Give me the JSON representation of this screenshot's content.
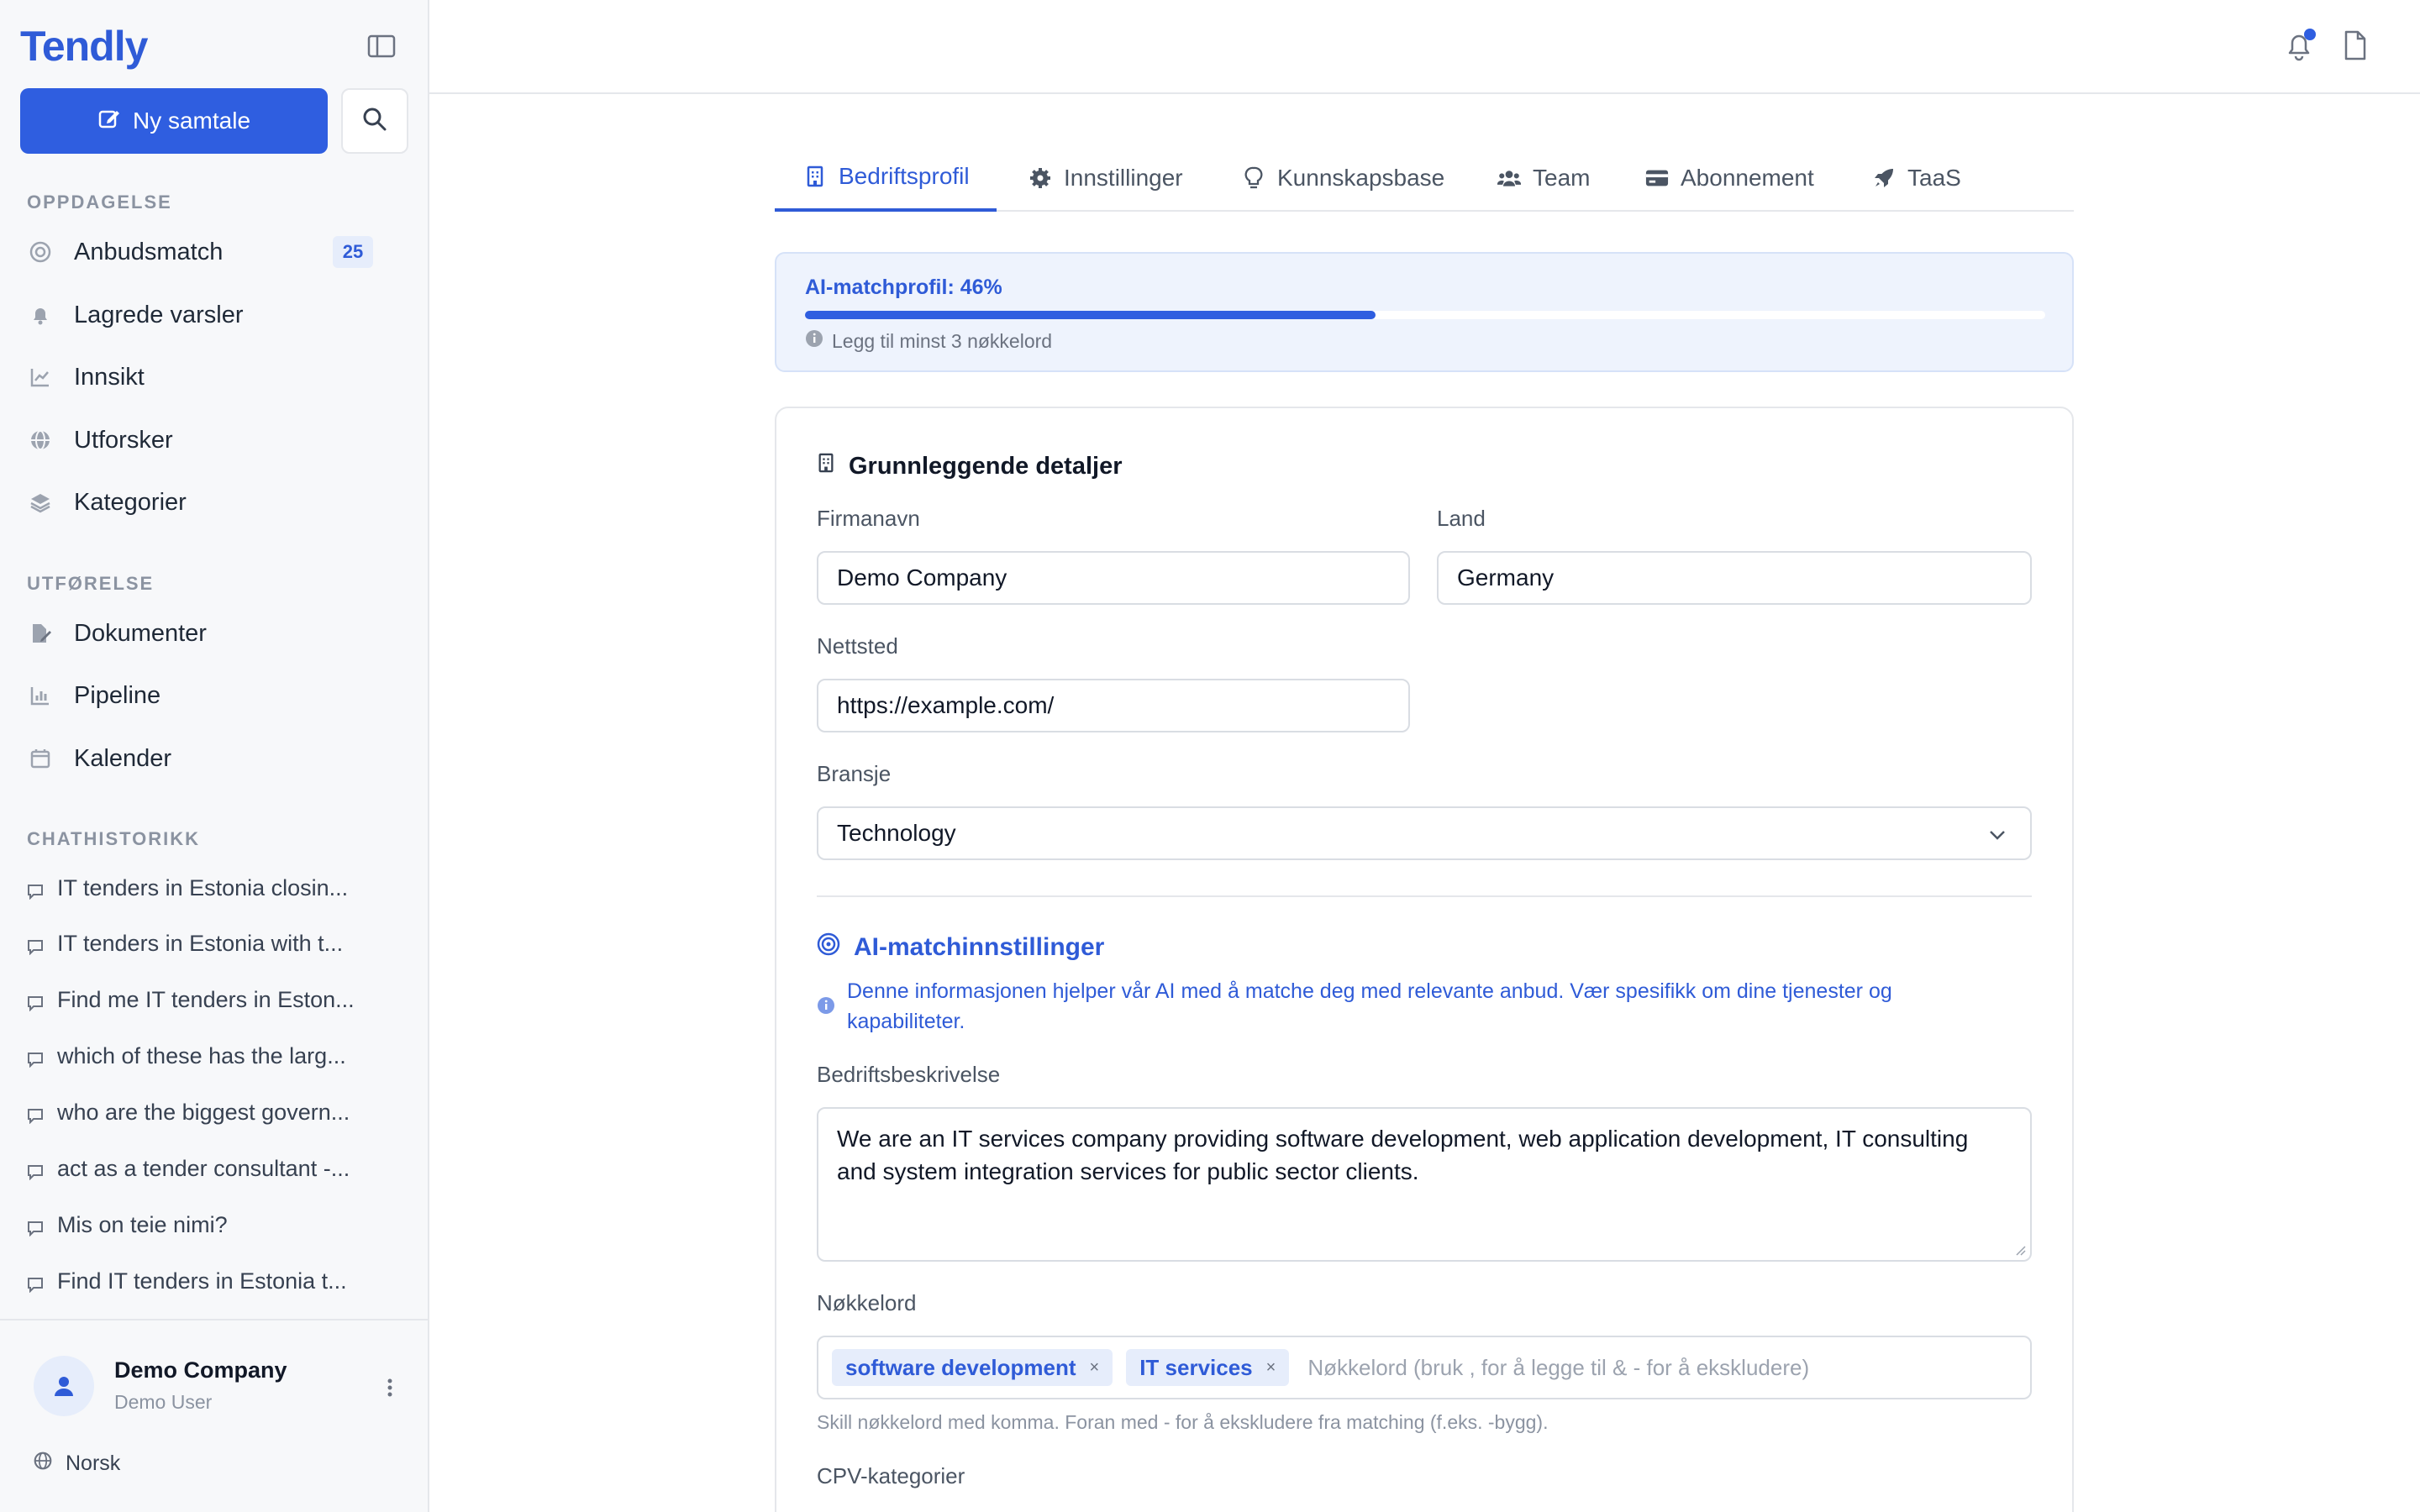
{
  "sidebar": {
    "brand": "Tendly",
    "new_chat_label": "Ny samtale",
    "sections": {
      "discovery": "OPPDAGELSE",
      "execution": "UTFØRELSE",
      "history": "CHATHISTORIKK"
    },
    "discovery_items": [
      {
        "label": "Anbudsmatch",
        "icon": "target-icon",
        "badge": "25"
      },
      {
        "label": "Lagrede varsler",
        "icon": "bell-icon"
      },
      {
        "label": "Innsikt",
        "icon": "line-chart-icon"
      },
      {
        "label": "Utforsker",
        "icon": "globe-icon"
      },
      {
        "label": "Kategorier",
        "icon": "layers-icon"
      }
    ],
    "execution_items": [
      {
        "label": "Dokumenter",
        "icon": "file-edit-icon"
      },
      {
        "label": "Pipeline",
        "icon": "bar-chart-icon"
      },
      {
        "label": "Kalender",
        "icon": "calendar-icon"
      }
    ],
    "chat_history": [
      "IT tenders in Estonia closin...",
      "IT tenders in Estonia with t...",
      "Find me IT tenders in Eston...",
      "which of these has the larg...",
      "who are the biggest govern...",
      "act as a tender consultant -...",
      "Mis on teie nimi?",
      "Find IT tenders in Estonia t..."
    ],
    "account": {
      "name": "Demo Company",
      "user": "Demo User"
    },
    "language": "Norsk"
  },
  "tabs": [
    {
      "label": "Bedriftsprofil",
      "icon": "building-icon",
      "active": true
    },
    {
      "label": "Innstillinger",
      "icon": "gear-icon",
      "active": false
    },
    {
      "label": "Kunnskapsbase",
      "icon": "lightbulb-icon",
      "active": false
    },
    {
      "label": "Team",
      "icon": "users-icon",
      "active": false
    },
    {
      "label": "Abonnement",
      "icon": "credit-card-icon",
      "active": false
    },
    {
      "label": "TaaS",
      "icon": "rocket-icon",
      "active": false
    }
  ],
  "match_profile": {
    "title": "AI-matchprofil: 46%",
    "percent": 46,
    "hint": "Legg til minst 3 nøkkelord"
  },
  "basic_details": {
    "heading": "Grunnleggende detaljer",
    "company_label": "Firmanavn",
    "company_value": "Demo Company",
    "country_label": "Land",
    "country_value": "Germany",
    "website_label": "Nettsted",
    "website_value": "https://example.com/",
    "industry_label": "Bransje",
    "industry_value": "Technology"
  },
  "ai_settings": {
    "heading": "AI-matchinnstillinger",
    "info": "Denne informasjonen hjelper vår AI med å matche deg med relevante anbud. Vær spesifikk om dine tjenester og kapabiliteter.",
    "description_label": "Bedriftsbeskrivelse",
    "description_value": "We are an IT services company providing software development, web application development, IT consulting and system integration services for public sector clients.",
    "keywords_label": "Nøkkelord",
    "keywords": [
      "software development",
      "IT services"
    ],
    "keywords_placeholder": "Nøkkelord (bruk , for å legge til & - for å ekskludere)",
    "keywords_help": "Skill nøkkelord med komma. Foran med - for å ekskludere fra matching (f.eks. -bygg).",
    "cpv_label": "CPV-kategorier"
  },
  "colors": {
    "accent": "#2f5ee0",
    "accent_text": "#2f5bd7",
    "accent_bg": "#e6edfb"
  }
}
